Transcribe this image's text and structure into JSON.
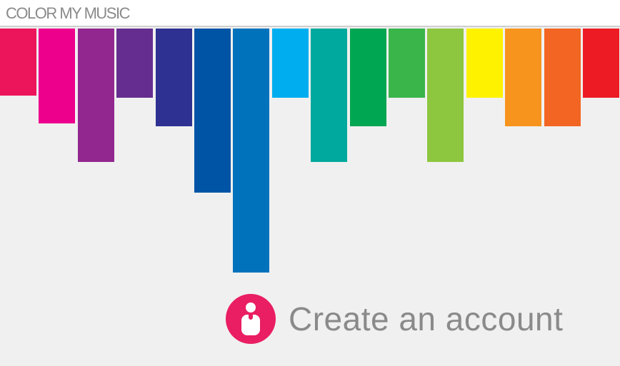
{
  "header": {
    "brand": "COLOR MY MUSIC"
  },
  "color_bars": [
    {
      "color": "#ec145a",
      "level": 0.26
    },
    {
      "color": "#ec008c",
      "level": 0.37
    },
    {
      "color": "#92278f",
      "level": 0.52
    },
    {
      "color": "#662d91",
      "level": 0.27
    },
    {
      "color": "#2e3192",
      "level": 0.38
    },
    {
      "color": "#0054a6",
      "level": 0.64
    },
    {
      "color": "#0072bc",
      "level": 0.95
    },
    {
      "color": "#00aeef",
      "level": 0.27
    },
    {
      "color": "#00a99d",
      "level": 0.52
    },
    {
      "color": "#00a651",
      "level": 0.38
    },
    {
      "color": "#39b54a",
      "level": 0.27
    },
    {
      "color": "#8dc63f",
      "level": 0.52
    },
    {
      "color": "#fff200",
      "level": 0.27
    },
    {
      "color": "#f7941d",
      "level": 0.38
    },
    {
      "color": "#f26522",
      "level": 0.38
    },
    {
      "color": "#ed1c24",
      "level": 0.27
    }
  ],
  "cta": {
    "label": "Create an account",
    "icon": "user-icon",
    "icon_color": "#e91e63"
  }
}
